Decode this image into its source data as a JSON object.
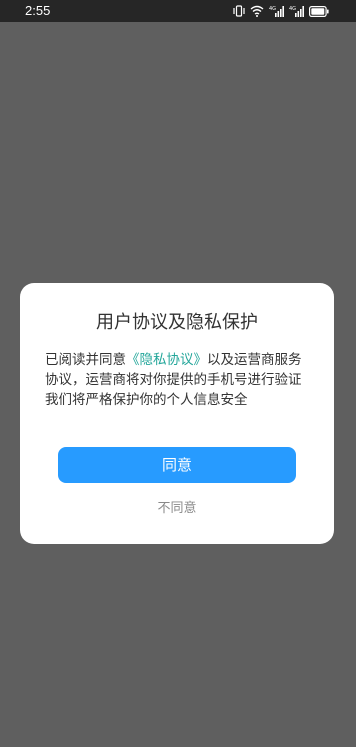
{
  "status_bar": {
    "time": "2:55",
    "icons": [
      "vibrate-icon",
      "wifi-icon",
      "signal-icon",
      "signal-icon",
      "battery-icon"
    ],
    "signal1_tag": "4G",
    "signal2_tag": "4G"
  },
  "dialog": {
    "title": "用户协议及隐私保护",
    "body_prefix": "已阅读并同意",
    "privacy_link": "《隐私协议》",
    "body_suffix": "以及运营商服务协议，运营商将对你提供的手机号进行验证",
    "body_line2": "我们将严格保护你的个人信息安全",
    "agree_label": "同意",
    "disagree_label": "不同意"
  },
  "colors": {
    "overlay": "#5f5f5f",
    "status_bar": "#262626",
    "primary_button": "#279bff",
    "link": "#23a69a"
  }
}
